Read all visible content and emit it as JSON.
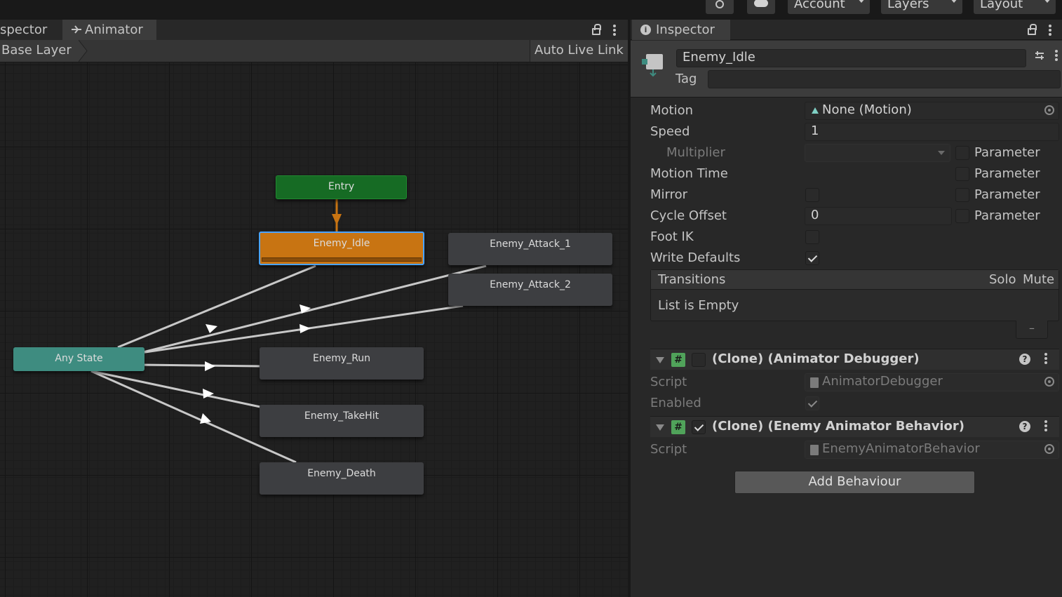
{
  "topbar": {
    "account_label": "Account",
    "layers_label": "Layers",
    "layout_label": "Layout",
    "icons": [
      "play-settings-icon",
      "cloud-icon",
      "chevron-down-icon"
    ]
  },
  "left_panel": {
    "tabs": [
      {
        "label": "spector"
      },
      {
        "label": "Animator",
        "icon": "animator-icon"
      }
    ],
    "breadcrumb": "Base Layer",
    "auto_live_link": "Auto Live Link",
    "states": {
      "entry": "Entry",
      "any_state": "Any State",
      "idle": "Enemy_Idle",
      "attack1": "Enemy_Attack_1",
      "attack2": "Enemy_Attack_2",
      "run": "Enemy_Run",
      "takehit": "Enemy_TakeHit",
      "death": "Enemy_Death"
    },
    "colors": {
      "entry": "#166b24",
      "any_state": "#3e8c80",
      "selected_default_state": "#c87412",
      "selection_outline": "#4aa3ff",
      "default_transition": "#c87412",
      "transition": "#c8c8c8"
    }
  },
  "inspector": {
    "tab_label": "Inspector",
    "tab_icon": "info-icon",
    "state_name": "Enemy_Idle",
    "tag_label": "Tag",
    "tag_value": "",
    "properties": {
      "motion_label": "Motion",
      "motion_value": "None (Motion)",
      "speed_label": "Speed",
      "speed_value": "1",
      "multiplier_label": "Multiplier",
      "motion_time_label": "Motion Time",
      "mirror_label": "Mirror",
      "cycle_offset_label": "Cycle Offset",
      "cycle_offset_value": "0",
      "foot_ik_label": "Foot IK",
      "write_defaults_label": "Write Defaults",
      "parameter_label": "Parameter"
    },
    "transitions": {
      "title": "Transitions",
      "solo": "Solo",
      "mute": "Mute",
      "empty": "List is Empty",
      "remove": "–"
    },
    "behaviours": [
      {
        "title": "(Clone) (Animator Debugger)",
        "enabled": false,
        "script_label": "Script",
        "script_value": "AnimatorDebugger",
        "enabled_label": "Enabled"
      },
      {
        "title": "(Clone) (Enemy Animator Behavior)",
        "enabled": true,
        "script_label": "Script",
        "script_value": "EnemyAnimatorBehavior"
      }
    ],
    "add_behaviour": "Add Behaviour"
  }
}
